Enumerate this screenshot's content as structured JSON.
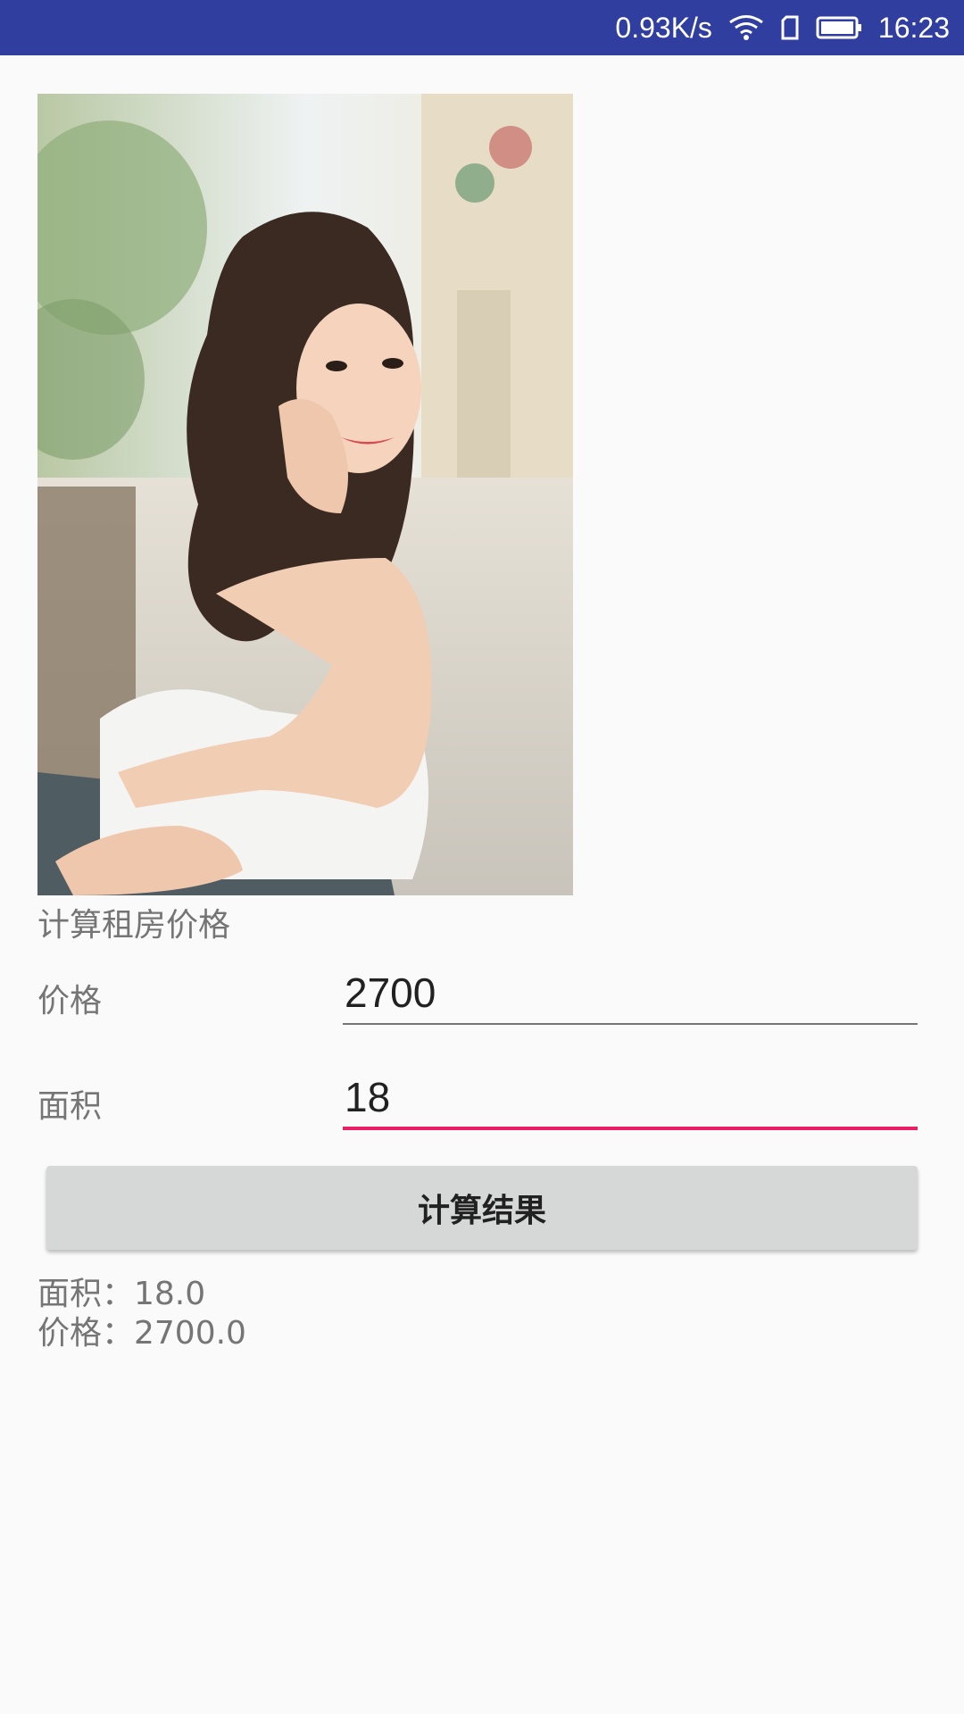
{
  "status_bar": {
    "network_speed": "0.93K/s",
    "time": "16:23",
    "icons": [
      "wifi-icon",
      "sim-card-icon",
      "battery-icon"
    ]
  },
  "photo": {
    "subject": "woman-portrait-photo"
  },
  "form": {
    "section_title": "计算租房价格",
    "price_label": "价格",
    "price_value": "2700",
    "area_label": "面积",
    "area_value": "18",
    "calculate_button_label": "计算结果"
  },
  "results": {
    "area_line": "面积：18.0",
    "price_line": "价格：2700.0"
  },
  "colors": {
    "status_bar": "#303f9f",
    "accent": "#e91e63",
    "button": "#d6d7d7"
  }
}
